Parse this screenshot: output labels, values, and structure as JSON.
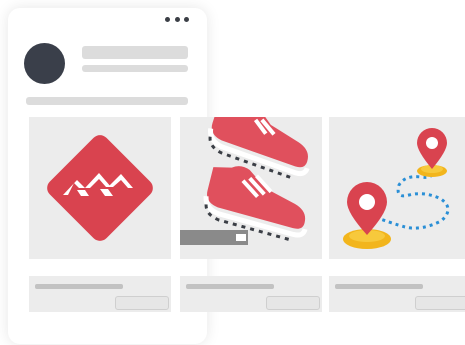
{
  "post": {
    "menu_icon": "more-horizontal-icon",
    "avatar_color": "#3a3f4a"
  },
  "cards": [
    {
      "icon": "brand-logo-icon",
      "accent": "#d9434f"
    },
    {
      "icon": "sneakers-icon",
      "accent": "#e0505d"
    },
    {
      "icon": "route-pins-icon",
      "accent": "#d9434f",
      "pin_base": "#f2b51c",
      "route": "#2a8fd6"
    }
  ]
}
